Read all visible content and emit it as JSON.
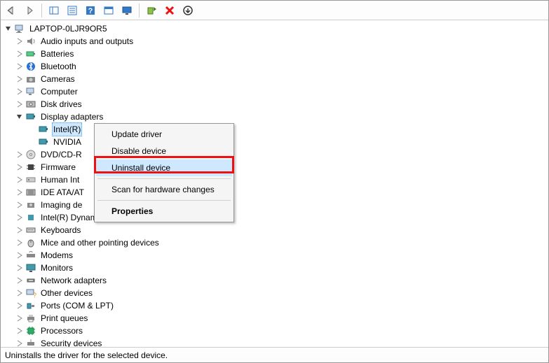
{
  "toolbar": {
    "back_icon": "back-arrow-icon",
    "forward_icon": "forward-arrow-icon",
    "showhide_icon": "showhide-icon",
    "properties_icon": "properties-icon",
    "help_icon": "help-icon",
    "view_icon": "view-icon",
    "monitor_icon": "monitor-icon",
    "update_icon": "update-driver-icon",
    "uninstall_icon": "uninstall-icon",
    "scan_icon": "scan-icon"
  },
  "tree": {
    "root_label": "LAPTOP-0LJR9OR5",
    "nodes": {
      "audio": "Audio inputs and outputs",
      "batteries": "Batteries",
      "bluetooth": "Bluetooth",
      "cameras": "Cameras",
      "computer": "Computer",
      "disk_drives": "Disk drives",
      "display_adapters": "Display adapters",
      "display_intel": "Intel(R)",
      "display_nvidia": "NVIDIA",
      "dvdcd": "DVD/CD-R",
      "firmware": "Firmware",
      "human_interface": "Human Int",
      "ide": "IDE ATA/AT",
      "imaging": "Imaging de",
      "intel_dptf": "Intel(R) Dynamic Platform and Thermal Framework",
      "keyboards": "Keyboards",
      "mice": "Mice and other pointing devices",
      "modems": "Modems",
      "monitors": "Monitors",
      "network": "Network adapters",
      "other": "Other devices",
      "ports": "Ports (COM & LPT)",
      "printqueues": "Print queues",
      "processors": "Processors",
      "security": "Security devices"
    }
  },
  "context_menu": {
    "update_driver": "Update driver",
    "disable_device": "Disable device",
    "uninstall_device": "Uninstall device",
    "scan": "Scan for hardware changes",
    "properties": "Properties"
  },
  "status_bar": {
    "text": "Uninstalls the driver for the selected device."
  },
  "colors": {
    "selection": "#cde8ff",
    "highlight_border": "#e11"
  }
}
